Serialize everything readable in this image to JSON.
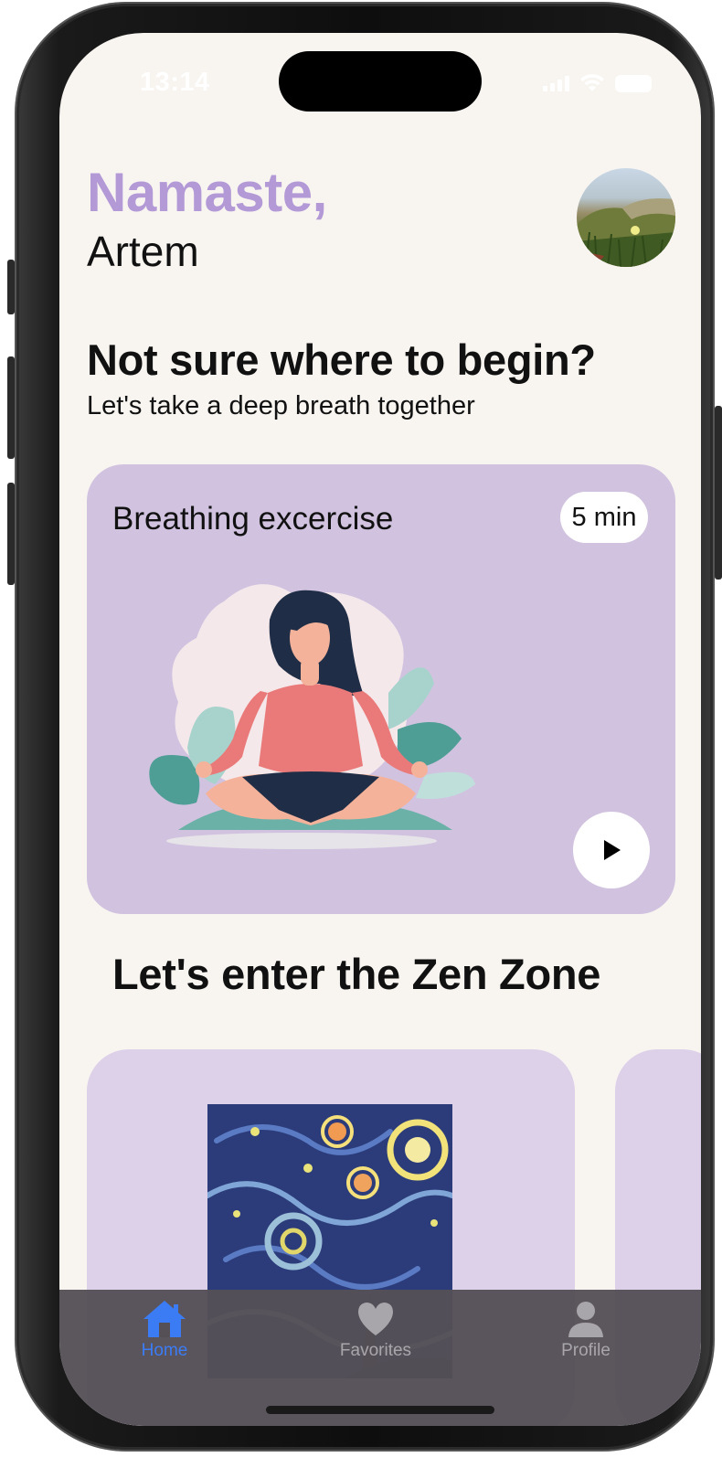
{
  "status_bar": {
    "time": "13:14"
  },
  "header": {
    "greeting": "Namaste,",
    "username": "Artem"
  },
  "intro": {
    "title": "Not sure where to begin?",
    "subtitle": "Let's take a deep breath together"
  },
  "breathing_card": {
    "title": "Breathing excercise",
    "duration": "5 min"
  },
  "zen_section": {
    "title": "Let's enter the Zen Zone"
  },
  "tab_bar": {
    "items": [
      {
        "label": "Home",
        "icon": "house-icon",
        "active": true
      },
      {
        "label": "Favorites",
        "icon": "heart-icon",
        "active": false
      },
      {
        "label": "Profile",
        "icon": "person-icon",
        "active": false
      }
    ]
  },
  "colors": {
    "accent_purple": "#b39ad6",
    "card_purple": "#d1c3e0",
    "active_tab": "#3b7cf5",
    "background": "#f8f5f1"
  }
}
